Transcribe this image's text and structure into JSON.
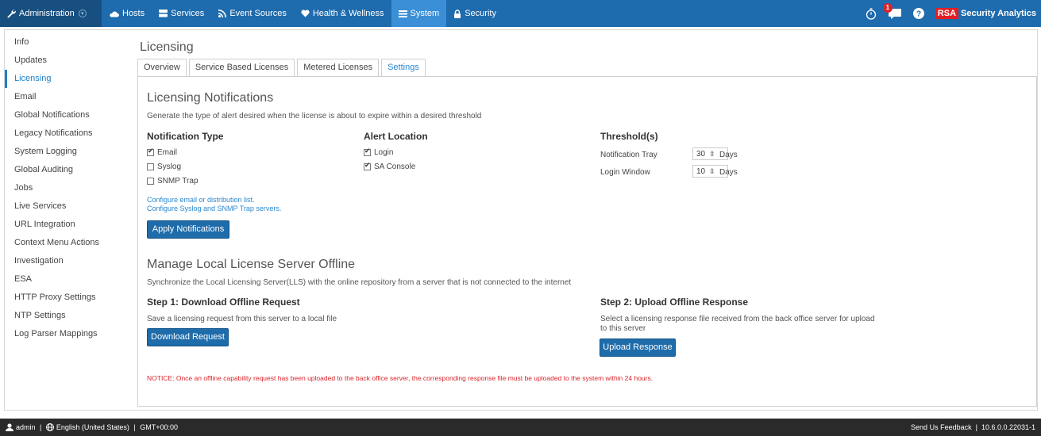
{
  "topnav": {
    "admin_label": "Administration",
    "items": [
      {
        "label": "Hosts",
        "icon": "cloud-icon"
      },
      {
        "label": "Services",
        "icon": "server-icon"
      },
      {
        "label": "Event Sources",
        "icon": "feed-icon"
      },
      {
        "label": "Health & Wellness",
        "icon": "heart-icon"
      },
      {
        "label": "System",
        "icon": "list-icon"
      },
      {
        "label": "Security",
        "icon": "lock-icon"
      }
    ],
    "active": "System",
    "notification_count": "1",
    "brand_box": "RSA",
    "brand_text": "Security Analytics",
    "colors": {
      "bar": "#1e6bad",
      "active": "#3b8fd6",
      "admin": "#174f80"
    }
  },
  "sidebar": {
    "items": [
      {
        "label": "Info"
      },
      {
        "label": "Updates"
      },
      {
        "label": "Licensing"
      },
      {
        "label": "Email"
      },
      {
        "label": "Global Notifications"
      },
      {
        "label": "Legacy Notifications"
      },
      {
        "label": "System Logging"
      },
      {
        "label": "Global Auditing"
      },
      {
        "label": "Jobs"
      },
      {
        "label": "Live Services"
      },
      {
        "label": "URL Integration"
      },
      {
        "label": "Context Menu Actions"
      },
      {
        "label": "Investigation"
      },
      {
        "label": "ESA"
      },
      {
        "label": "HTTP Proxy Settings"
      },
      {
        "label": "NTP Settings"
      },
      {
        "label": "Log Parser Mappings"
      }
    ],
    "active": "Licensing"
  },
  "main": {
    "title": "Licensing",
    "tabs": [
      {
        "label": "Overview"
      },
      {
        "label": "Service Based Licenses"
      },
      {
        "label": "Metered Licenses"
      },
      {
        "label": "Settings"
      }
    ],
    "active_tab": "Settings"
  },
  "notifications": {
    "heading": "Licensing Notifications",
    "description": "Generate the type of alert desired when the license is about to expire within a desired threshold",
    "type_heading": "Notification Type",
    "types": [
      {
        "label": "Email",
        "checked": true
      },
      {
        "label": "Syslog",
        "checked": false
      },
      {
        "label": "SNMP Trap",
        "checked": false
      }
    ],
    "location_heading": "Alert Location",
    "locations": [
      {
        "label": "Login",
        "checked": true
      },
      {
        "label": "SA Console",
        "checked": true
      }
    ],
    "threshold_heading": "Threshold(s)",
    "thresholds": [
      {
        "label": "Notification Tray",
        "value": "30",
        "unit": "Days"
      },
      {
        "label": "Login Window",
        "value": "10",
        "unit": "Days"
      }
    ],
    "link_email": "Configure email or distribution list.",
    "link_syslog": "Configure Syslog and SNMP Trap servers.",
    "apply_button": "Apply Notifications"
  },
  "offline": {
    "heading": "Manage Local License Server Offline",
    "description": "Synchronize the Local Licensing Server(LLS) with the online repository from a server that is not connected to the internet",
    "step1_heading": "Step 1: Download Offline Request",
    "step1_desc": "Save a licensing request from this server to a local file",
    "download_button": "Download Request",
    "step2_heading": "Step 2: Upload Offline Response",
    "step2_desc": "Select a licensing response file received from the back office server for upload to this server",
    "upload_button": "Upload Response",
    "notice": "NOTICE: Once an offline capability request has been uploaded to the back office server, the corresponding response file must be uploaded to the system within 24 hours."
  },
  "footer": {
    "user": "admin",
    "language": "English (United States)",
    "timezone": "GMT+00:00",
    "feedback": "Send Us Feedback",
    "version": "10.6.0.0.22031-1"
  }
}
